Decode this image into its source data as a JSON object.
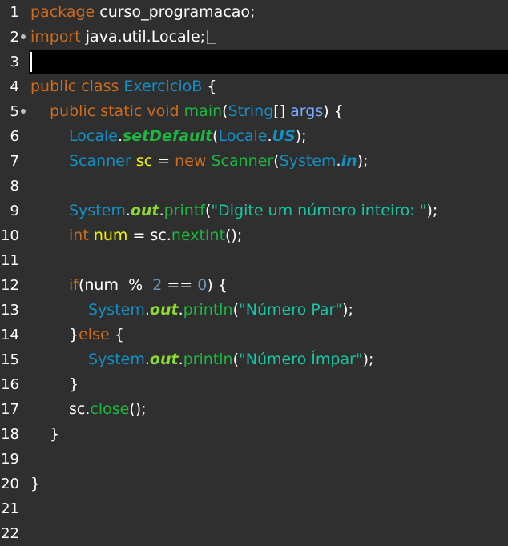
{
  "line_numbers": [
    "1",
    "2",
    "3",
    "4",
    "5",
    "6",
    "7",
    "8",
    "9",
    "10",
    "11",
    "12",
    "13",
    "14",
    "15",
    "16",
    "17",
    "18",
    "19",
    "20",
    "21",
    "22"
  ],
  "code": {
    "l1": {
      "kw": "package",
      "rest": " curso_programacao;"
    },
    "l2": {
      "kw": "import",
      "rest": " java.util.Locale;"
    },
    "l5": {
      "kw": "public class",
      "name": "ExercicioB",
      "rest": " {"
    },
    "l6": {
      "kw": "public static void",
      "fn": "main",
      "p1": "(",
      "type": "String",
      "p2": "[] ",
      "param": "args",
      "p3": ") {"
    },
    "l7": {
      "cls": "Locale",
      "dot1": ".",
      "method": "setDefault",
      "p1": "(",
      "cls2": "Locale",
      "dot2": ".",
      "field": "US",
      "p2": ");"
    },
    "l8": {
      "cls": "Scanner",
      "var": "sc",
      "eq": " = ",
      "kw": "new",
      "ctor": "Scanner",
      "p1": "(",
      "cls2": "System",
      "dot": ".",
      "field": "in",
      "p2": ");"
    },
    "l10": {
      "cls": "System",
      "dot": ".",
      "field": "out",
      "dot2": ".",
      "fn": "printf",
      "p1": "(",
      "str": "\"Digite um número inteiro: \"",
      "p2": ");"
    },
    "l11": {
      "kw": "int",
      "var": "num",
      "eq": " = ",
      "obj": "sc",
      "dot": ".",
      "fn": "nextInt",
      "p": "();"
    },
    "l13": {
      "kw": "if",
      "p1": "(",
      "var": "num",
      "op": "  %  ",
      "n1": "2",
      "eq": " == ",
      "n2": "0",
      "p2": ") {"
    },
    "l14": {
      "cls": "System",
      "dot": ".",
      "field": "out",
      "dot2": ".",
      "fn": "println",
      "p1": "(",
      "str": "\"Número Par\"",
      "p2": ");"
    },
    "l15": {
      "b": "}",
      "kw": "else",
      "rest": " {"
    },
    "l16": {
      "cls": "System",
      "dot": ".",
      "field": "out",
      "dot2": ".",
      "fn": "println",
      "p1": "(",
      "str": "\"Número Ímpar\"",
      "p2": ");"
    },
    "l17": {
      "text": "}"
    },
    "l18": {
      "obj": "sc",
      "dot": ".",
      "fn": "close",
      "p": "();"
    },
    "l19": {
      "text": "}"
    },
    "l21": {
      "text": "}"
    }
  },
  "colors": {
    "background": "#2f2f2f",
    "current_line": "#000000",
    "keyword": "#cc6c1d",
    "class": "#1290c3",
    "method": "#1eb540",
    "string": "#17c6a3",
    "number": "#6897bb",
    "variable": "#f2f200",
    "parameter": "#79abff",
    "static_field": "#8dda32"
  },
  "icons": [
    "fold-marker-icon",
    "collapsed-fold-box-icon"
  ]
}
